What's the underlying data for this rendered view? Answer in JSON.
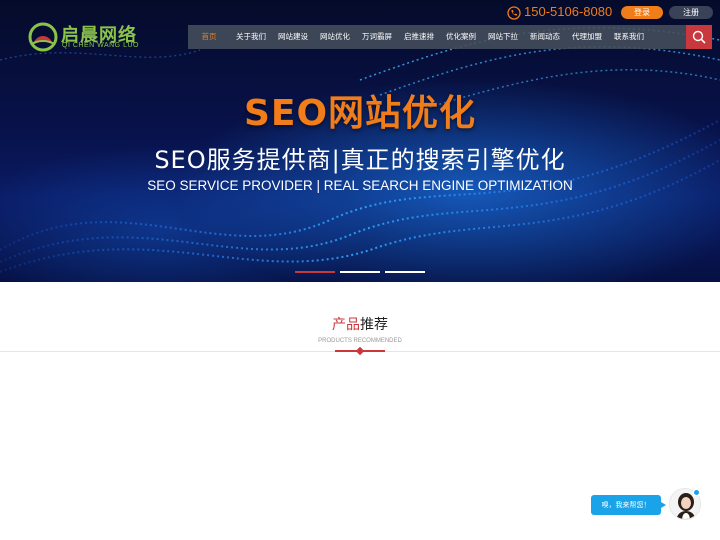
{
  "brand": {
    "name": "启晨网络",
    "name_en": "QI CHEN WANG LUO"
  },
  "topbar": {
    "phone": "150-5106-8080",
    "login_label": "登录",
    "register_label": "注册"
  },
  "nav": {
    "items": [
      {
        "label": "首页",
        "active": true
      },
      {
        "label": "关于我们"
      },
      {
        "label": "网站建设"
      },
      {
        "label": "网站优化"
      },
      {
        "label": "万词霸屏"
      },
      {
        "label": "启推速排"
      },
      {
        "label": "优化案例"
      },
      {
        "label": "网站下拉"
      },
      {
        "label": "新闻动态"
      },
      {
        "label": "代理加盟"
      },
      {
        "label": "联系我们"
      }
    ],
    "search_icon": "search-icon"
  },
  "hero": {
    "title": "SEO网站优化",
    "subtitle": "SEO服务提供商|真正的搜索引擎优化",
    "subtitle_en": "SEO SERVICE PROVIDER | REAL SEARCH ENGINE OPTIMIZATION",
    "slides": 3,
    "active_slide": 1
  },
  "section": {
    "title_highlight": "产品",
    "title_rest": "推荐",
    "subtitle_en": "PRODUCTS RECOMMENDED"
  },
  "chat": {
    "bubble_text": "嗅，我来帮您！"
  },
  "colors": {
    "accent": "#f07c1a",
    "red": "#c8383d",
    "nav_bg": "#464e5c",
    "brand_green": "#8bc34a",
    "chat_blue": "#1aa3e8"
  }
}
